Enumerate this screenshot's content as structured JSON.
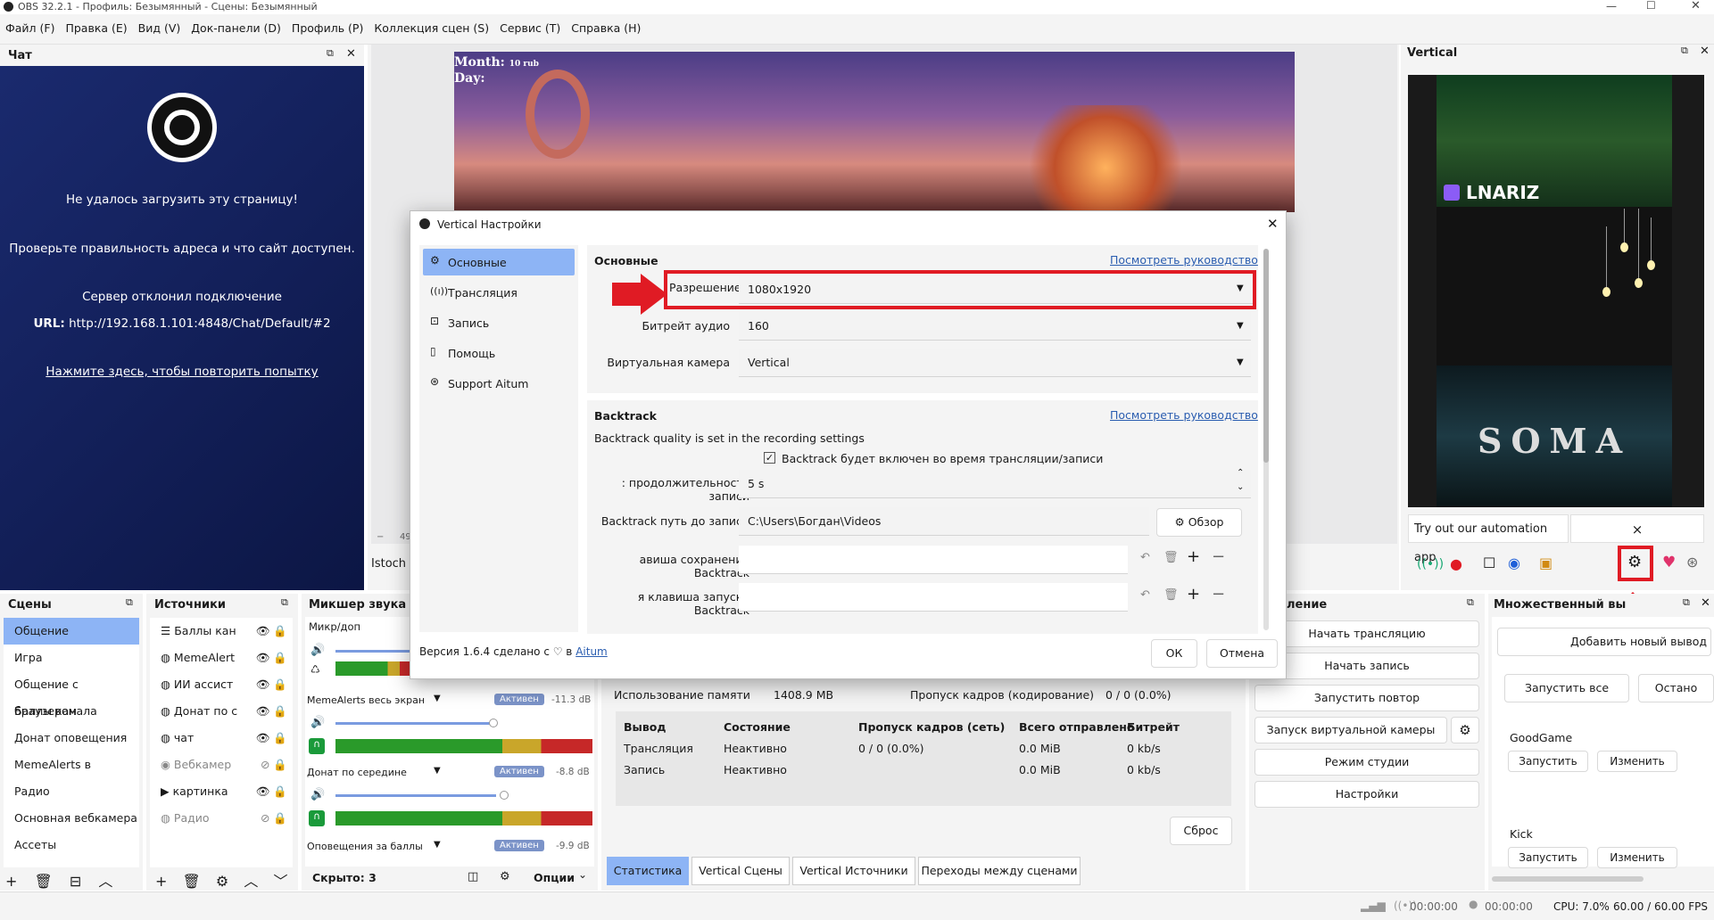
{
  "titlebar": {
    "title": "OBS 32.2.1 - Профиль: Безымянный - Сцены: Безымянный"
  },
  "menu": [
    "Файл (F)",
    "Правка (E)",
    "Вид (V)",
    "Док-панели (D)",
    "Профиль (P)",
    "Коллекция сцен (S)",
    "Сервис (T)",
    "Справка (H)"
  ],
  "chat": {
    "title": "Чат",
    "err1": "Не удалось загрузить эту страницу!",
    "err2": "Проверьте правильность адреса и что сайт доступен.",
    "err3": "Сервер отклонил подключение",
    "url_label": "URL:",
    "url": "http://192.168.1.101:4848/Chat/Default/#2",
    "retry": "Нажмите здесь, чтобы повторить попытку"
  },
  "preview": {
    "overlay1": "Month:",
    "overlay2": "Day:",
    "overlay3": "10 rub",
    "overlay4": "Istoch",
    "overlay5": "49"
  },
  "vertical": {
    "title": "Vertical",
    "banner1": "LNARIZ",
    "banner2": "SOMA",
    "ad": "Try out our automation app",
    "ad_close": "×"
  },
  "scenes": {
    "title": "Сцены",
    "items": [
      "Общение",
      "Игра",
      "Общение с браузером",
      "Баллы канала",
      "Донат оповещения",
      "MemeAlerts в",
      "Радио",
      "Основная вебкамера",
      "Ассеты"
    ]
  },
  "sources": {
    "title": "Источники",
    "items": [
      "Баллы кан",
      "MemeAlert",
      "ИИ ассист",
      "Донат по с",
      "чат",
      "Вебкамер",
      "картинка",
      "Радио"
    ]
  },
  "mixer": {
    "title": "Микшер звука",
    "hidden": "Скрыто: 3",
    "options": "Опции",
    "channels": [
      {
        "name": "Микр/доп",
        "badge": "",
        "db": ""
      },
      {
        "name": "MemeAlerts весь экран",
        "badge": "Активен",
        "db": "-11.3 dB"
      },
      {
        "name": "Донат по середине",
        "badge": "Активен",
        "db": "-8.8 dB"
      },
      {
        "name": "Оповещения за баллы",
        "badge": "Активен",
        "db": "-9.9 dB"
      }
    ],
    "scale": [
      "-60",
      "-54",
      "-48",
      "-42",
      "-36",
      "-30",
      "-24",
      "-18",
      "-12",
      "-6",
      "0"
    ]
  },
  "stats": {
    "memory_label": "Использование памяти",
    "memory_value": "1408.9 MB",
    "skip_label": "Пропуск кадров (кодирование)",
    "skip_value": "0 / 0 (0.0%)",
    "headers": [
      "Вывод",
      "Состояние",
      "Пропуск кадров (сеть)",
      "Всего отправлено",
      "Битрейт"
    ],
    "rows": [
      [
        "Трансляция",
        "Неактивно",
        "0 / 0 (0.0%)",
        "0.0 MiB",
        "0 kb/s"
      ],
      [
        "Запись",
        "Неактивно",
        "",
        "0.0 MiB",
        "0 kb/s"
      ]
    ],
    "reset": "Сброс"
  },
  "bottom_tabs": [
    "Статистика",
    "Vertical Сцены",
    "Vertical Источники",
    "Переходы между сценами"
  ],
  "controls": {
    "title": "ление",
    "buttons": [
      "Начать трансляцию",
      "Начать запись",
      "Запустить повтор",
      "Запуск виртуальной камеры",
      "Режим студии",
      "Настройки"
    ]
  },
  "multi": {
    "title": "Множественный вы",
    "add": "Добавить новый вывод",
    "start_all": "Запустить все",
    "stop_all": "Остано",
    "services": [
      {
        "name": "GoodGame",
        "start": "Запустить",
        "edit": "Изменить"
      },
      {
        "name": "Kick",
        "start": "Запустить",
        "edit": "Изменить"
      }
    ]
  },
  "status": {
    "rec_time": "00:00:00",
    "stream_time": "00:00:00",
    "cpu": "CPU: 7.0%",
    "fps": "60.00 / 60.00 FPS"
  },
  "dialog": {
    "title": "Vertical Настройки",
    "nav": [
      "Основные",
      "Трансляция",
      "Запись",
      "Помощь",
      "Support Aitum"
    ],
    "sec1": "Основные",
    "guide": "Посмотреть руководство",
    "res_label": "Разрешение",
    "res_value": "1080x1920",
    "bitrate_label": "Битрейт аудио",
    "bitrate_value": "160",
    "vcam_label": "Виртуальная камера",
    "vcam_value": "Vertical",
    "sec2": "Backtrack",
    "bt_note": "Backtrack quality is set in the recording settings",
    "bt_check": "Backtrack будет включен во время трансляции/записи",
    "bt_dur_label": ": продолжительность записи",
    "bt_dur_value": "5 s",
    "bt_path_label": "Backtrack путь до записи",
    "bt_path_value": "C:\\Users\\Богдан\\Videos",
    "browse": "Обзор",
    "bt_save_label": "авиша сохранения Backtrack",
    "bt_start_label": "я клавиша запуска Backtrack",
    "version": "Версия 1.6.4 сделано с ♡ в",
    "aitum": "Aitum",
    "ok": "ОК",
    "cancel": "Отмена"
  },
  "colors": {
    "accent": "#8db4f5",
    "highlight": "#e01b24"
  }
}
